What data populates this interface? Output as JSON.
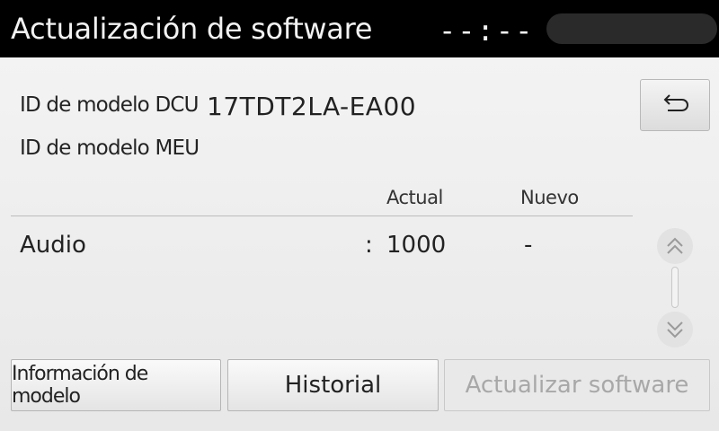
{
  "header": {
    "title": "Actualización de software",
    "clock": "--:--"
  },
  "model": {
    "dcu_label": "ID de modelo DCU",
    "dcu_value": "17TDT2LA-EA00",
    "meu_label": "ID de modelo MEU"
  },
  "table": {
    "columns": [
      "Actual",
      "Nuevo"
    ],
    "rows": [
      {
        "label": "Audio",
        "separator": ":",
        "actual": "1000",
        "nuevo": "-"
      }
    ]
  },
  "buttons": {
    "info": "Información de modelo",
    "history": "Historial",
    "update": "Actualizar software"
  },
  "icons": {
    "back": "back-arrow-icon",
    "scroll_up": "double-chevron-up-icon",
    "scroll_down": "double-chevron-down-icon"
  }
}
